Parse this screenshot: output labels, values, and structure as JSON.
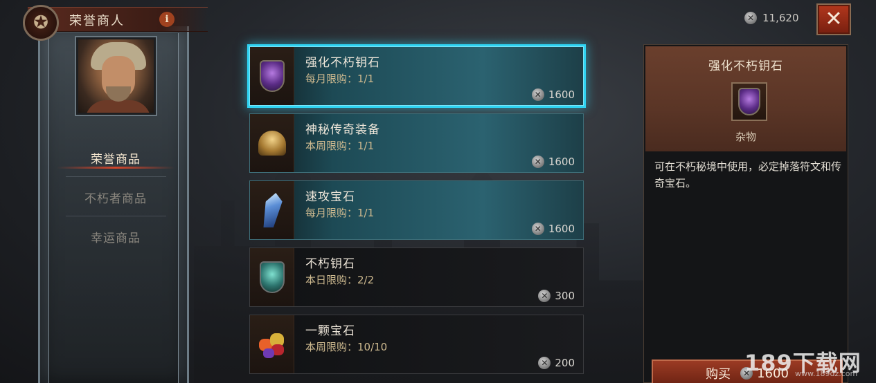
{
  "header": {
    "title": "荣誉商人",
    "info_icon": "i",
    "currency_icon": "coin-icon",
    "currency_amount": "11,620",
    "close_label": "✕"
  },
  "nav": {
    "items": [
      {
        "label": "荣誉商品",
        "active": true
      },
      {
        "label": "不朽者商品",
        "active": false
      },
      {
        "label": "幸运商品",
        "active": false
      }
    ]
  },
  "items": [
    {
      "name": "强化不朽钥石",
      "limit": "每月限购：1/1",
      "price": "1600",
      "icon": "purple-keystone-icon",
      "selected": true,
      "style": "teal"
    },
    {
      "name": "神秘传奇装备",
      "limit": "本周限购：1/1",
      "price": "1600",
      "icon": "helm-icon",
      "selected": false,
      "style": "teal"
    },
    {
      "name": "速攻宝石",
      "limit": "每月限购：1/1",
      "price": "1600",
      "icon": "crystal-icon",
      "selected": false,
      "style": "teal"
    },
    {
      "name": "不朽钥石",
      "limit": "本日限购：2/2",
      "price": "300",
      "icon": "keystone-icon",
      "selected": false,
      "style": "dark"
    },
    {
      "name": "一颗宝石",
      "limit": "本周限购：10/10",
      "price": "200",
      "icon": "gems-icon",
      "selected": false,
      "style": "dark"
    }
  ],
  "detail": {
    "title": "强化不朽钥石",
    "type": "杂物",
    "description": "可在不朽秘境中使用，必定掉落符文和传奇宝石。",
    "buy_label": "购买",
    "buy_price": "1600"
  },
  "watermark": {
    "text": "189下载网",
    "sub": "www.189dz.com"
  },
  "colors": {
    "accent_cyan": "#2fd3f2",
    "accent_red": "#b0361c",
    "gold_text": "#cdb98f"
  }
}
